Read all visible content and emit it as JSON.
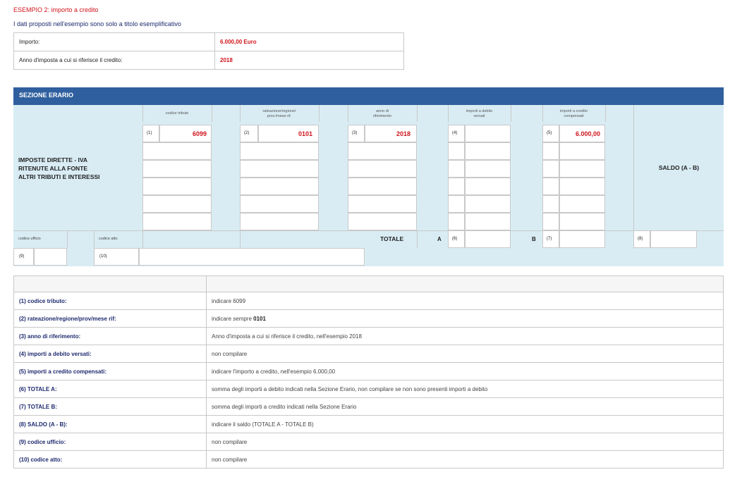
{
  "title": "ESEMPIO 2: importo a credito",
  "subtitle": "I dati proposti nell'esempio sono solo a titolo esemplificativo",
  "info": [
    {
      "label": "Importo:",
      "value": "6.000,00 Euro"
    },
    {
      "label": "Anno d'imposta a cui si riferisce il credito:",
      "value": "2018"
    }
  ],
  "erario": {
    "header": "SEZIONE ERARIO",
    "row_label_1": "IMPOSTE DIRETTE - IVA",
    "row_label_2": "RITENUTE ALLA FONTE",
    "row_label_3": "ALTRI TRIBUTI E INTERESSI",
    "col_codice": "codice tributo",
    "col_rateazione_1": "rateazione/regione/",
    "col_rateazione_2": "prov./mese rif.",
    "col_anno_1": "anno di",
    "col_anno_2": "riferimento",
    "col_debito_1": "importi a debito",
    "col_debito_2": "versati",
    "col_credito_1": "importi a credito",
    "col_credito_2": "compensati",
    "n1": "(1)",
    "n2": "(2)",
    "n3": "(3)",
    "n4": "(4)",
    "n5": "(5)",
    "n6": "(6)",
    "n7": "(7)",
    "n8": "(8)",
    "n9": "(9)",
    "n10": "(10)",
    "v_codice": "6099",
    "v_rateazione": "0101",
    "v_anno": "2018",
    "v_credito": "6.000,00",
    "saldo": "SALDO (A - B)",
    "totale": "TOTALE",
    "a": "A",
    "b": "B",
    "codice_ufficio": "codice ufficio",
    "codice_atto": "codice atto"
  },
  "legend": [
    {
      "k": "(1) codice tributo:",
      "v": "indicare 6099"
    },
    {
      "k": "(2) rateazione/regione/prov/mese rif:",
      "v": "indicare sempre ",
      "v_bold": "0101"
    },
    {
      "k": "(3) anno di riferimento:",
      "v": "Anno d'imposta a cui si riferisce il credito, nell'esempio 2018"
    },
    {
      "k": "(4) importi a debito versati:",
      "v": "non compilare"
    },
    {
      "k": "(5) importi a credito compensati:",
      "v": "indicare l'importo a credito, nell'esempio 6.000,00"
    },
    {
      "k": "(6) TOTALE A:",
      "v": "somma degli importi a debito indicati nella Sezione Erario, non compilare se non sono presenti importi a debito"
    },
    {
      "k": "(7) TOTALE B:",
      "v": "somma degli importi a credito indicati nella Sezione Erario"
    },
    {
      "k": "(8) SALDO (A - B):",
      "v": "indicare il saldo (TOTALE A - TOTALE B)"
    },
    {
      "k": "(9) codice ufficio:",
      "v": "non compilare"
    },
    {
      "k": "(10) codice atto:",
      "v": "non compilare"
    }
  ],
  "colors": {
    "accent_red": "#d0141b",
    "header_blue": "#2f5f9e",
    "panel_blue": "#d9ecf4",
    "navy": "#1e2a6e"
  }
}
